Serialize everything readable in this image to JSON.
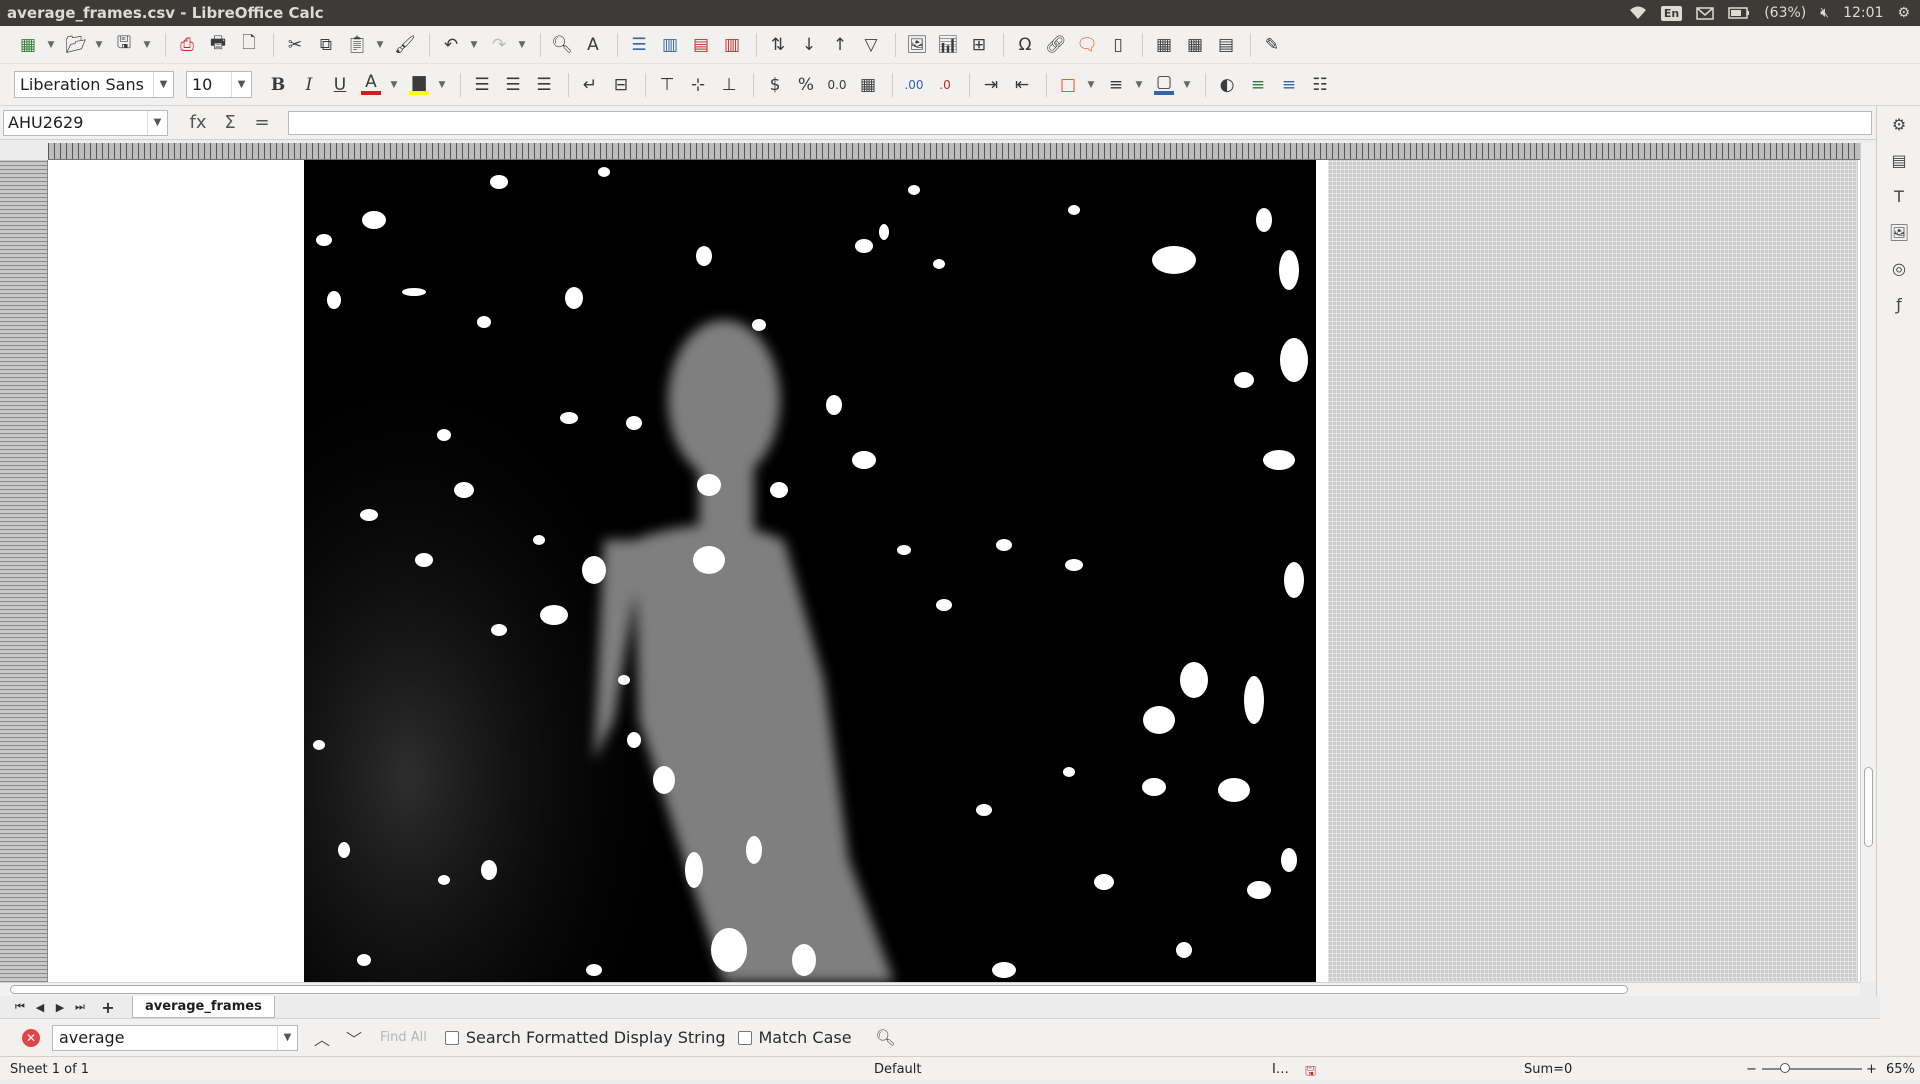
{
  "window": {
    "title": "average_frames.csv - LibreOffice Calc"
  },
  "tray": {
    "keyboard": "En",
    "battery": "(63%)",
    "time": "12:01"
  },
  "toolbar1": {
    "icons": [
      "new-spreadsheet-icon",
      "open-icon",
      "save-icon",
      "export-pdf-icon",
      "print-icon",
      "print-preview-icon",
      "cut-icon",
      "copy-icon",
      "paste-icon",
      "clone-formatting-icon",
      "undo-icon",
      "redo-icon",
      "find-replace-icon",
      "spelling-icon",
      "row-icon",
      "column-icon",
      "insert-icon",
      "delete-icon",
      "sort-icon",
      "sort-ascending-icon",
      "sort-descending-icon",
      "autofilter-icon",
      "image-icon",
      "chart-icon",
      "pivot-table-icon",
      "special-character-icon",
      "hyperlink-icon",
      "comment-icon",
      "headers-footers-icon",
      "define-print-area-icon",
      "freeze-icon",
      "split-window-icon",
      "show-draw-functions-icon"
    ]
  },
  "toolbar2": {
    "font_name": "Liberation Sans",
    "font_size": "10",
    "bold": "B",
    "italic": "I",
    "underline": "U",
    "currency": "$",
    "percent": "%",
    "number": "0.0",
    "font_color": "#c9211e",
    "highlight_color": "#ffff00",
    "border_color": "#3465a4"
  },
  "formula": {
    "name_box": "AHU2629",
    "fx": "fx",
    "sum": "Σ",
    "equals": "=",
    "content": ""
  },
  "sheet_tabs": {
    "active": "average_frames"
  },
  "find": {
    "query": "average",
    "find_all": "Find All",
    "formatted_label": "Search Formatted Display String",
    "match_case_label": "Match Case"
  },
  "status": {
    "sheet": "Sheet 1 of 1",
    "style": "Default",
    "sum": "Sum=0",
    "zoom": "65%",
    "minus": "−",
    "plus": "+"
  }
}
